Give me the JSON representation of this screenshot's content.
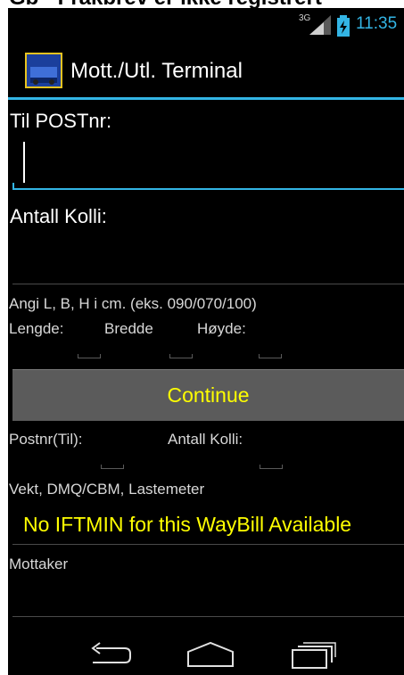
{
  "caption": "Gb - Frakbrev er ikke registrert",
  "status_bar": {
    "network": "3G",
    "time": "11:35",
    "color": "#33b5e5"
  },
  "action_bar": {
    "title": "Mott./Utl. Terminal",
    "icon": "app-terminal-icon"
  },
  "form": {
    "postnr_label": "Til POSTnr:",
    "postnr_value": "",
    "kolli_label": "Antall Kolli:",
    "kolli_value": "",
    "dimensions_hint": "Angi L, B, H i cm. (eks. 090/070/100)",
    "length_label": "Lengde:",
    "width_label": "Bredde",
    "height_label": "Høyde:",
    "continue_label": "Continue",
    "postnr_til_label": "Postnr(Til):",
    "antall_kolli_label": "Antall Kolli:",
    "weight_label": "Vekt, DMQ/CBM, Lastemeter",
    "iftmin_message": "No IFTMIN for this WayBill Available",
    "recipient_label": "Mottaker"
  },
  "colors": {
    "accent": "#33b5e5",
    "highlight": "#ffff00",
    "background": "#000000"
  },
  "nav": {
    "icons": [
      "back-icon",
      "home-icon",
      "recent-apps-icon"
    ]
  }
}
